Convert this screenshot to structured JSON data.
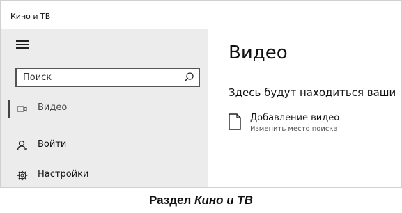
{
  "app": {
    "title": "Кино и ТВ"
  },
  "sidebar": {
    "search": {
      "placeholder": "Поиск"
    },
    "items": [
      {
        "label": "Видео",
        "icon": "video-camera-icon",
        "selected": true
      },
      {
        "label": "Войти",
        "icon": "person-icon"
      },
      {
        "label": "Настройки",
        "icon": "gear-icon"
      }
    ]
  },
  "main": {
    "title": "Видео",
    "empty_message": "Здесь будут находиться ваши",
    "add_folder": {
      "title": "Добавление видео",
      "subtitle": "Изменить место поиска",
      "icon": "document-icon"
    }
  },
  "caption": {
    "prefix": "Раздел",
    "emphasis": "Кино и ТВ"
  }
}
